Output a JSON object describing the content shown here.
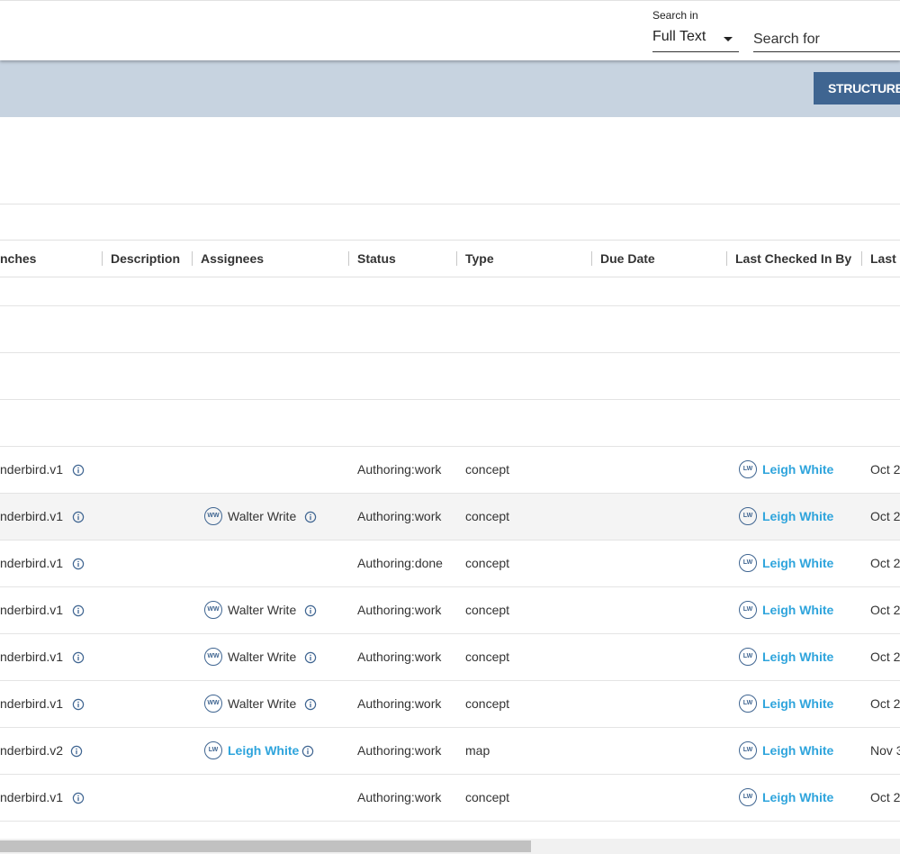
{
  "search": {
    "search_in_label": "Search in",
    "search_in_value": "Full Text",
    "search_for_placeholder": "Search for"
  },
  "toolbar": {
    "structure_label": "STRUCTURE"
  },
  "table": {
    "columns": [
      "nches",
      "Description",
      "Assignees",
      "Status",
      "Type",
      "Due Date",
      "Last Checked In By",
      "Last C"
    ],
    "rows": [
      {
        "branch": "nderbird.v1",
        "assignee": "",
        "assignee_initials": "",
        "status": "Authoring:work",
        "type": "concept",
        "checked_by": "Leigh White",
        "checked_initials": "LW",
        "last": "Oct 2"
      },
      {
        "branch": "nderbird.v1",
        "assignee": "Walter Write",
        "assignee_initials": "WW",
        "status": "Authoring:work",
        "type": "concept",
        "checked_by": "Leigh White",
        "checked_initials": "LW",
        "last": "Oct 2"
      },
      {
        "branch": "nderbird.v1",
        "assignee": "",
        "assignee_initials": "",
        "status": "Authoring:done",
        "type": "concept",
        "checked_by": "Leigh White",
        "checked_initials": "LW",
        "last": "Oct 2"
      },
      {
        "branch": "nderbird.v1",
        "assignee": "Walter Write",
        "assignee_initials": "WW",
        "status": "Authoring:work",
        "type": "concept",
        "checked_by": "Leigh White",
        "checked_initials": "LW",
        "last": "Oct 2"
      },
      {
        "branch": "nderbird.v1",
        "assignee": "Walter Write",
        "assignee_initials": "WW",
        "status": "Authoring:work",
        "type": "concept",
        "checked_by": "Leigh White",
        "checked_initials": "LW",
        "last": "Oct 2"
      },
      {
        "branch": "nderbird.v1",
        "assignee": "Walter Write",
        "assignee_initials": "WW",
        "status": "Authoring:work",
        "type": "concept",
        "checked_by": "Leigh White",
        "checked_initials": "LW",
        "last": "Oct 2"
      },
      {
        "branch": "nderbird.v2",
        "assignee": "Leigh White",
        "assignee_initials": "LW",
        "status": "Authoring:work",
        "type": "map",
        "checked_by": "Leigh White",
        "checked_initials": "LW",
        "last": "Nov 3"
      },
      {
        "branch": "nderbird.v1",
        "assignee": "",
        "assignee_initials": "",
        "status": "Authoring:work",
        "type": "concept",
        "checked_by": "Leigh White",
        "checked_initials": "LW",
        "last": "Oct 2"
      }
    ]
  },
  "icons": {
    "info": "info-icon",
    "dropdown": "caret-down-icon"
  },
  "colors": {
    "band": "#c7d3e0",
    "button": "#3f6591",
    "link": "#2ea4dc",
    "avatar_ring": "#3f6591"
  }
}
